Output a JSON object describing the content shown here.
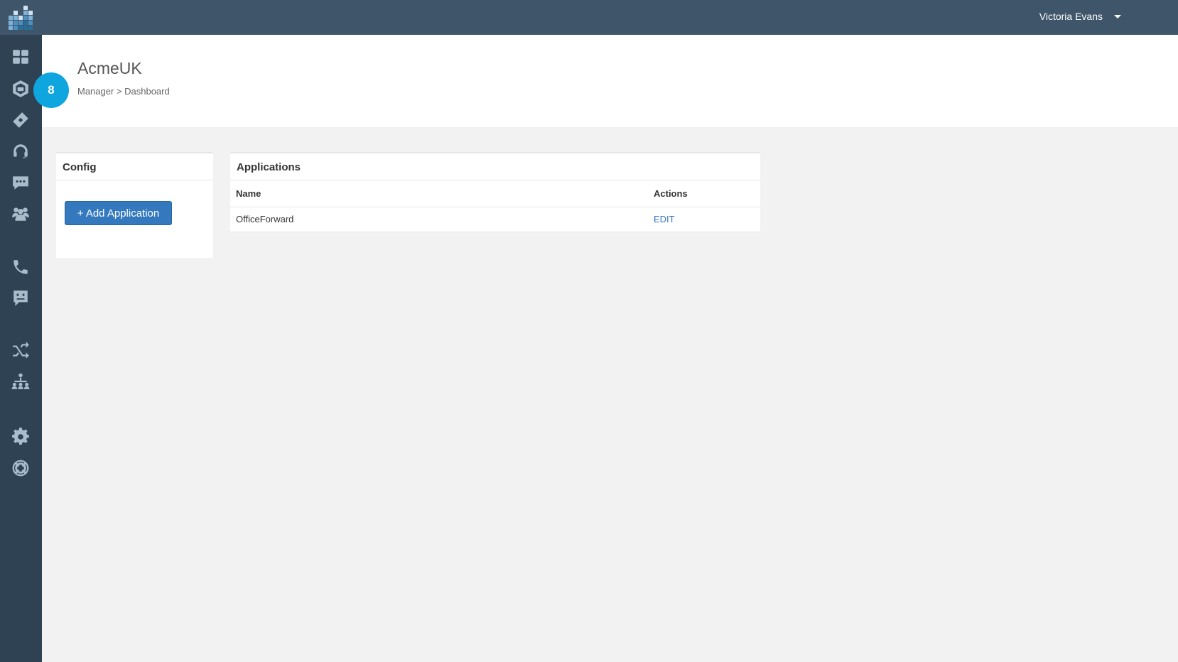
{
  "header": {
    "user_name": "Victoria Evans"
  },
  "page": {
    "title": "AcmeUK",
    "breadcrumb": "Manager > Dashboard",
    "badge_count": "8"
  },
  "sidebar": {
    "icons": [
      "dashboard-icon",
      "hexagon-chat-icon",
      "ticket-icon",
      "headset-icon",
      "chat-bubble-icon",
      "users-icon",
      "phone-icon",
      "message-square-icon",
      "shuffle-icon",
      "org-chart-icon",
      "gear-icon",
      "lifebuoy-icon"
    ]
  },
  "config": {
    "title": "Config",
    "add_label": "+ Add Application"
  },
  "applications": {
    "title": "Applications",
    "columns": [
      "Name",
      "Actions"
    ],
    "rows": [
      {
        "name": "OfficeForward",
        "action": "EDIT"
      }
    ]
  },
  "colors": {
    "topbar": "#3f556a",
    "sidebar": "#2f4254",
    "accent": "#3478bd",
    "badge": "#0fa6df"
  }
}
